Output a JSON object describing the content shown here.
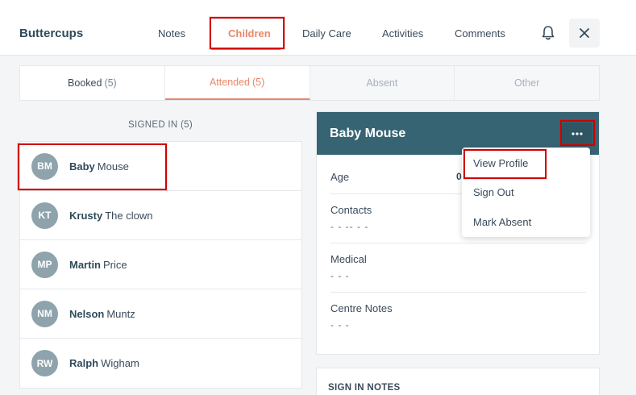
{
  "header": {
    "brand": "Buttercups",
    "nav": [
      "Notes",
      "Children",
      "Daily Care",
      "Activities",
      "Comments"
    ],
    "active_nav": "Children"
  },
  "tabs": [
    {
      "label": "Booked",
      "count": "(5)"
    },
    {
      "label": "Attended",
      "count": "(5)"
    },
    {
      "label": "Absent",
      "count": ""
    },
    {
      "label": "Other",
      "count": ""
    }
  ],
  "signed_in": {
    "heading": "SIGNED IN (5)",
    "children": [
      {
        "initials": "BM",
        "first": "Baby",
        "last": "Mouse"
      },
      {
        "initials": "KT",
        "first": "Krusty",
        "last": "The clown"
      },
      {
        "initials": "MP",
        "first": "Martin",
        "last": "Price"
      },
      {
        "initials": "NM",
        "first": "Nelson",
        "last": "Muntz"
      },
      {
        "initials": "RW",
        "first": "Ralph",
        "last": "Wigham"
      }
    ]
  },
  "detail": {
    "name": "Baby Mouse",
    "age_label": "Age",
    "age_value": "0",
    "contacts_label": "Contacts",
    "contacts_value": "- - -- - -",
    "medical_label": "Medical",
    "medical_value": "- - -",
    "notes_label": "Centre Notes",
    "notes_value": "- - -"
  },
  "menu": {
    "items": [
      "View Profile",
      "Sign Out",
      "Mark Absent"
    ]
  },
  "sign_in_notes": {
    "title": "SIGN IN NOTES"
  },
  "colors": {
    "accent": "#e8876a",
    "card_header": "#376473",
    "avatar": "#8ea3ab",
    "highlight": "#d10000"
  }
}
